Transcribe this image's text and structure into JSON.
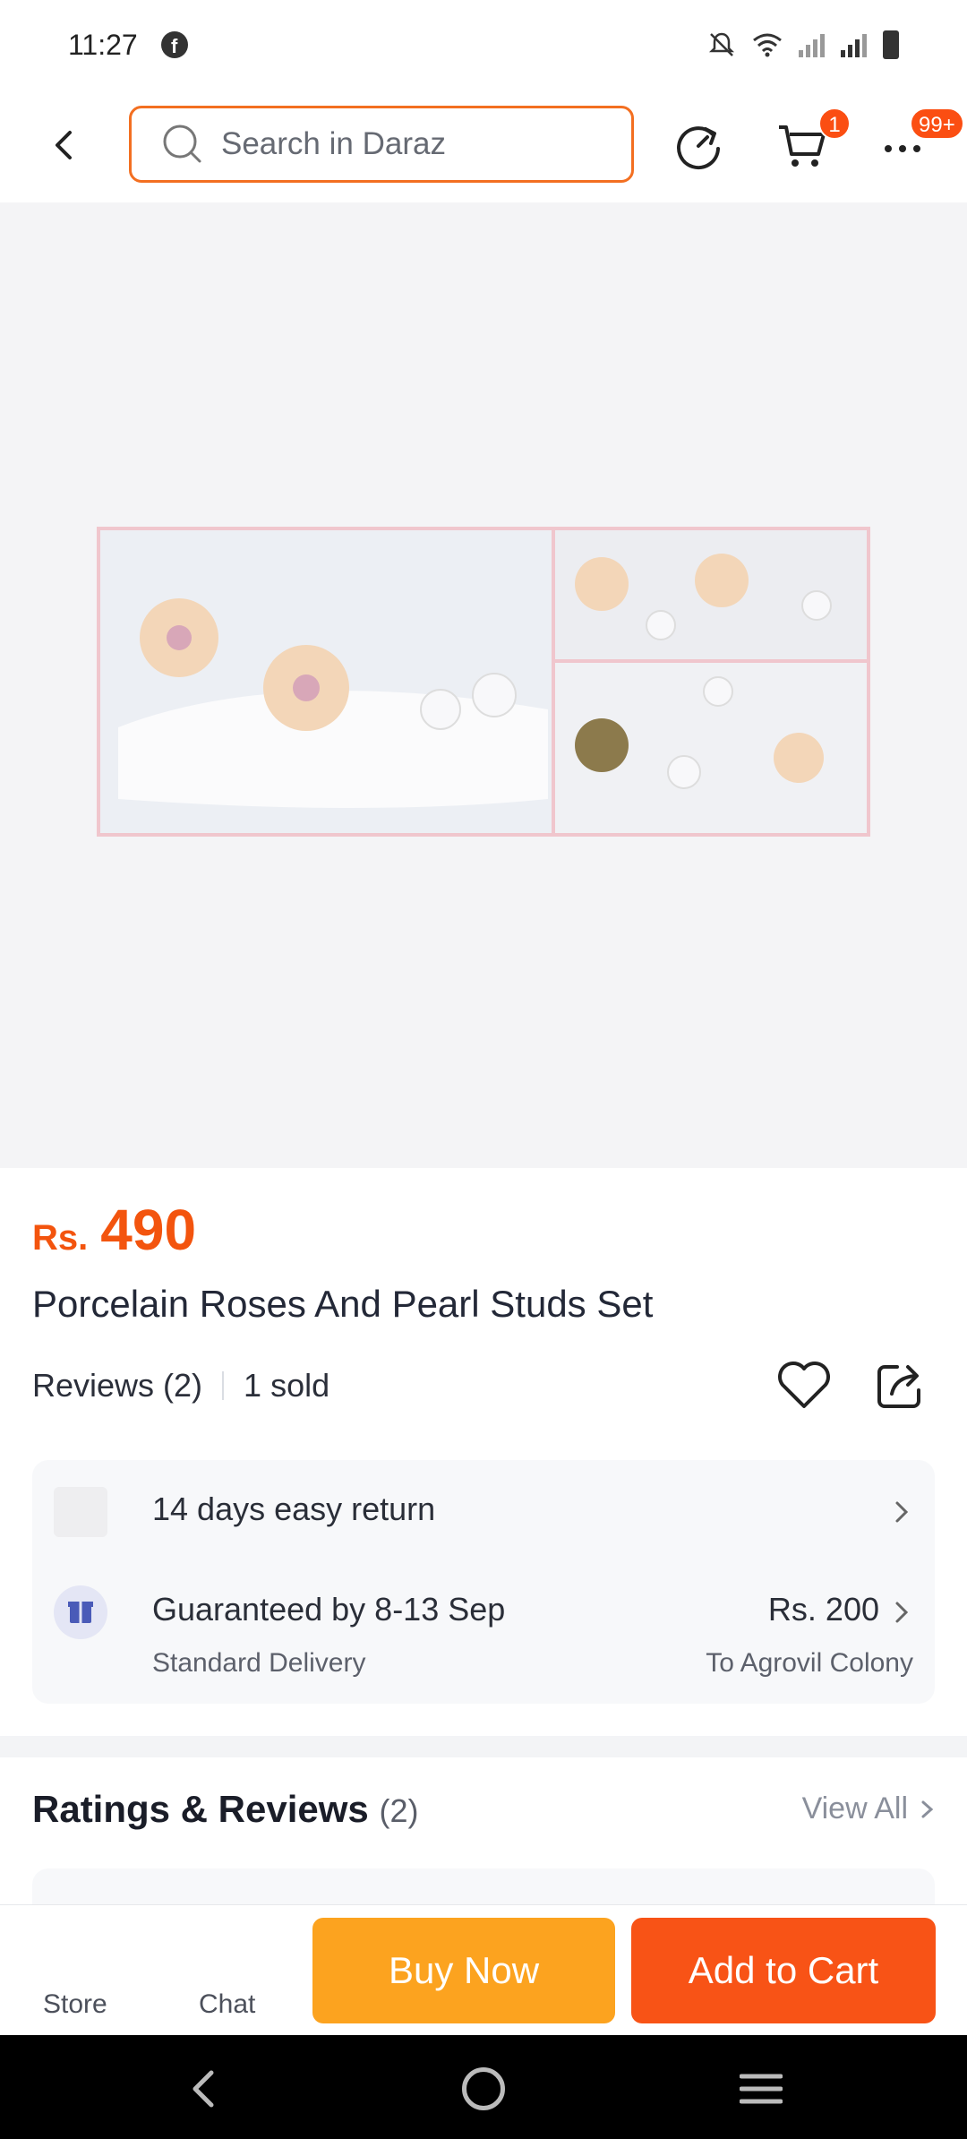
{
  "status_bar": {
    "time": "11:27",
    "app_icon": "facebook-icon"
  },
  "header": {
    "search_placeholder": "Search in Daraz",
    "cart_badge": "1",
    "more_badge": "99+",
    "accent": "#f36f21"
  },
  "product": {
    "currency": "Rs.",
    "price": "490",
    "title": "Porcelain Roses And Pearl Studs Set",
    "reviews": "Reviews (2)",
    "sold": "1 sold"
  },
  "service": {
    "return_text": "14 days easy return",
    "delivery_title": "Guaranteed by 8-13 Sep",
    "delivery_type": "Standard Delivery",
    "delivery_price": "Rs. 200",
    "delivery_dest": "To Agrovil Colony"
  },
  "ratings": {
    "title": "Ratings & Reviews",
    "count": "(2)",
    "view_all": "View All"
  },
  "action_bar": {
    "store": "Store",
    "chat": "Chat",
    "buy_now": "Buy Now",
    "add_to_cart": "Add to Cart",
    "buy_color": "#fca31f",
    "cart_color": "#f85316"
  }
}
